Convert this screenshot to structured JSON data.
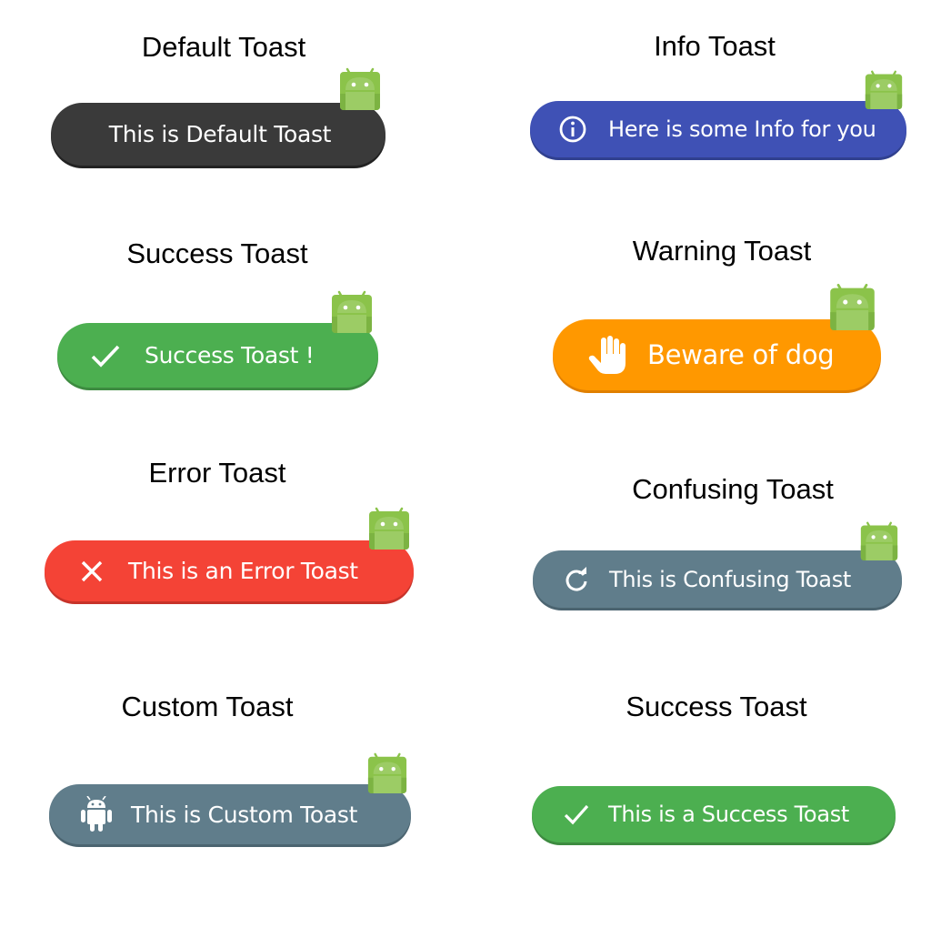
{
  "colors": {
    "default": "#3a3a3a",
    "info": "#3f51b5",
    "success": "#4caf50",
    "warning": "#ff9800",
    "error": "#f44336",
    "confusing": "#607d8b",
    "custom": "#607d8b",
    "android_badge": "#8bc34a"
  },
  "toasts": [
    {
      "heading": "Default Toast",
      "message": "This is Default Toast",
      "icon": null
    },
    {
      "heading": "Info Toast",
      "message": "Here is some Info for you",
      "icon": "info-icon"
    },
    {
      "heading": "Success Toast",
      "message": "Success Toast !",
      "icon": "check-icon"
    },
    {
      "heading": "Warning Toast",
      "message": "Beware of dog",
      "icon": "hand-icon"
    },
    {
      "heading": "Error Toast",
      "message": "This is an Error Toast",
      "icon": "close-icon"
    },
    {
      "heading": "Confusing Toast",
      "message": "This is Confusing Toast",
      "icon": "refresh-icon"
    },
    {
      "heading": "Custom Toast",
      "message": "This is Custom Toast",
      "icon": "android-icon"
    },
    {
      "heading": "Success Toast",
      "message": "This is a Success Toast",
      "icon": "check-icon"
    }
  ]
}
